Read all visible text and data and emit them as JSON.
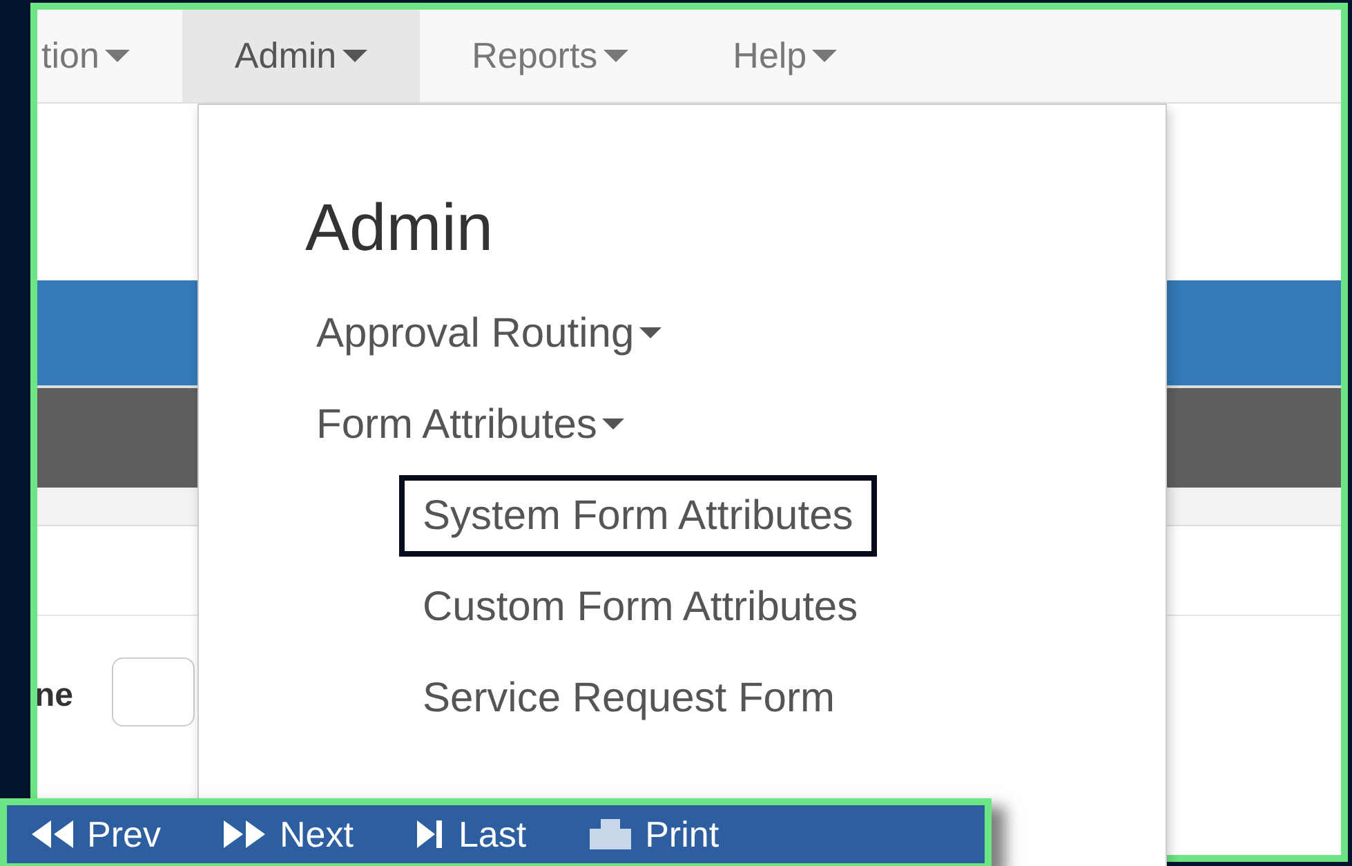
{
  "navbar": {
    "items": [
      {
        "label": "tion",
        "selected": false
      },
      {
        "label": "Admin",
        "selected": true
      },
      {
        "label": "Reports",
        "selected": false
      },
      {
        "label": "Help",
        "selected": false
      }
    ]
  },
  "form": {
    "field_label": "ne"
  },
  "admin_menu": {
    "title": "Admin",
    "items": [
      {
        "label": "Approval Routing"
      },
      {
        "label": "Form Attributes",
        "children": [
          {
            "label": "System Form Attributes",
            "selected": true
          },
          {
            "label": "Custom Form Attributes",
            "selected": false
          },
          {
            "label": "Service Request Form",
            "selected": false
          }
        ]
      }
    ]
  },
  "toolbar": {
    "buttons": [
      {
        "label": "Prev",
        "kind": "prev"
      },
      {
        "label": "Next",
        "kind": "next"
      },
      {
        "label": "Last",
        "kind": "last"
      },
      {
        "label": "Print",
        "kind": "print"
      }
    ]
  }
}
